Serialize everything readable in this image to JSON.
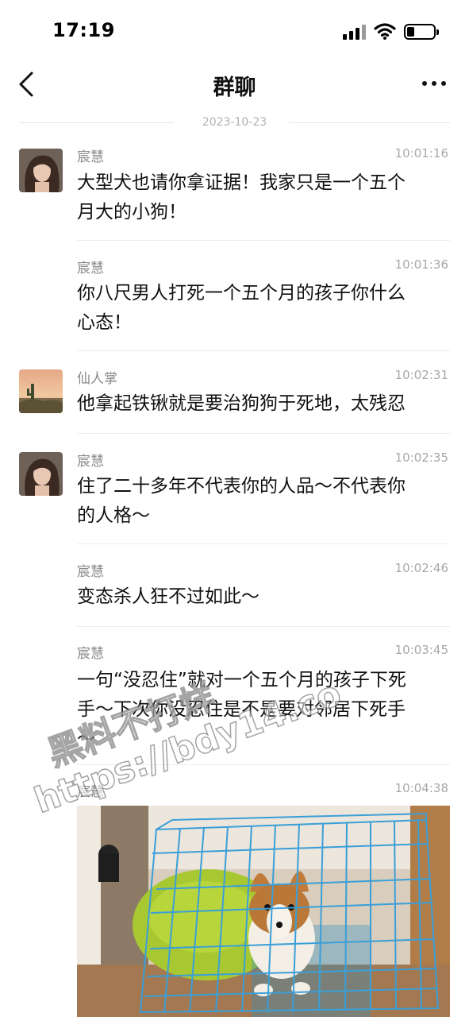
{
  "status_bar": {
    "time": "17:19"
  },
  "header": {
    "title": "群聊"
  },
  "date_divider": "2023-10-23",
  "messages": [
    {
      "sender": "宸慧",
      "time": "10:01:16",
      "lines": [
        "大型犬也请你拿证据！我家只是一个五个",
        "月大的小狗！"
      ],
      "avatar": "woman-portrait"
    },
    {
      "sender": "宸慧",
      "time": "10:01:36",
      "lines": [
        "你八尺男人打死一个五个月的孩子你什么",
        "心态！"
      ]
    },
    {
      "sender": "仙人掌",
      "time": "10:02:31",
      "lines": [
        "他拿起铁锹就是要治狗狗于死地，太残忍"
      ],
      "avatar": "cactus-sunset"
    },
    {
      "sender": "宸慧",
      "time": "10:02:35",
      "lines": [
        "住了二十多年不代表你的人品～不代表你",
        "的人格～"
      ],
      "avatar": "woman-portrait"
    },
    {
      "sender": "宸慧",
      "time": "10:02:46",
      "lines": [
        "变态杀人狂不过如此～"
      ]
    },
    {
      "sender": "宸慧",
      "time": "10:03:45",
      "lines": [
        "一句“没忍住”就对一个五个月的孩子下死",
        "手～下次你没忍住是不是要对邻居下死手",
        "～"
      ]
    },
    {
      "sender": "宸慧",
      "time": "10:04:38",
      "image": "corgi-puppy-in-blue-wire-cage"
    }
  ],
  "watermark": {
    "line1": "黑料不打烊",
    "line2": "https://bdy14.co"
  },
  "colors": {
    "divider": "#ececec",
    "meta_text": "#a8a8a8",
    "cage_blue": "#3a9fd8",
    "mat_green": "#a8c832"
  }
}
